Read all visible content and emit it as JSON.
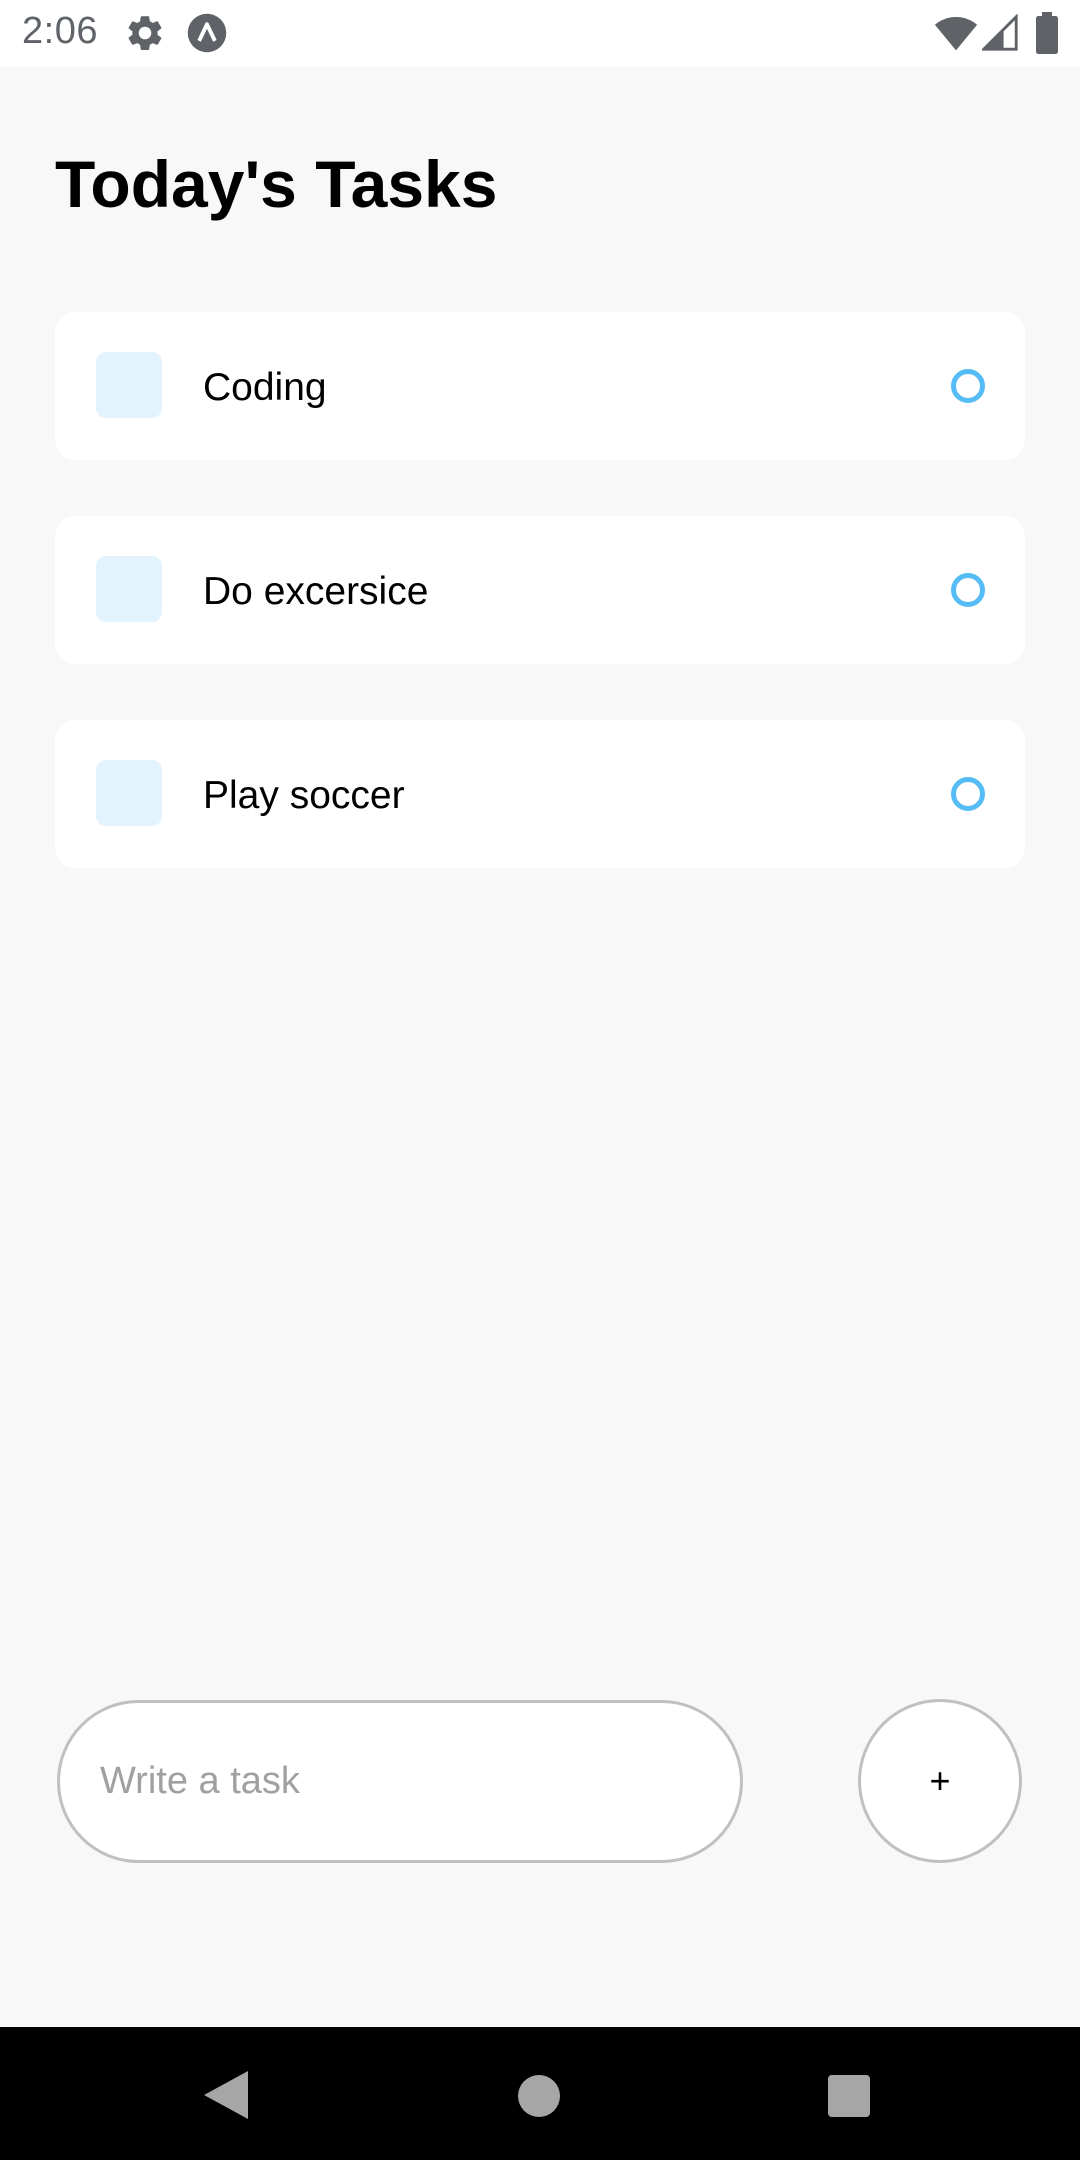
{
  "status_bar": {
    "time": "2:06",
    "icons": [
      "gear-icon",
      "app-a-icon",
      "wifi-icon",
      "signal-icon",
      "battery-icon"
    ]
  },
  "header": {
    "title": "Today's Tasks"
  },
  "tasks": [
    {
      "label": "Coding"
    },
    {
      "label": "Do excersice"
    },
    {
      "label": "Play soccer"
    }
  ],
  "composer": {
    "placeholder": "Write a task",
    "value": "",
    "add_label": "+"
  },
  "nav_bar": {
    "icons": [
      "back-icon",
      "home-icon",
      "recents-icon"
    ]
  },
  "colors": {
    "background": "#f8f8f8",
    "card": "#ffffff",
    "task_square": "#e3f3fd",
    "task_circle": "#55bcf6",
    "input_border": "#c0c0c0"
  }
}
